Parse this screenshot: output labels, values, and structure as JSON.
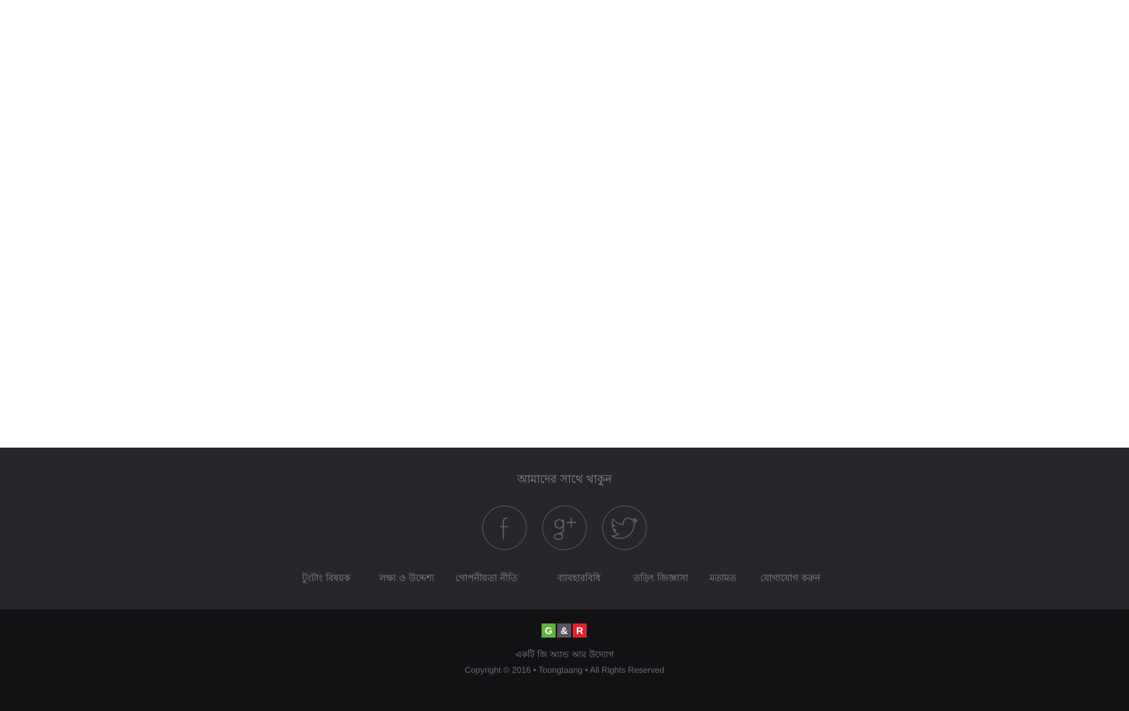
{
  "footer": {
    "follow_title": "আমাদের সাথে থাকুন",
    "social": [
      {
        "name": "facebook",
        "icon": "facebook-icon"
      },
      {
        "name": "google-plus",
        "icon": "google-plus-icon"
      },
      {
        "name": "twitter",
        "icon": "twitter-icon"
      }
    ],
    "links": [
      {
        "label": "টুংটাং বিষয়ক"
      },
      {
        "label": "লক্ষ্য ও উদ্দেশ্য"
      },
      {
        "label": "গোপনীয়তা নীতি"
      },
      {
        "label": "ব্যাবহারবিধি"
      },
      {
        "label": "তড়িৎ জিজ্ঞাসা"
      },
      {
        "label": "মতামত"
      },
      {
        "label": "যোগাযোগ করুন"
      }
    ]
  },
  "bottom": {
    "logo": {
      "g": "G",
      "amp": "&",
      "r": "R"
    },
    "initiative": "একটি জি অ্যান্ড আর উদ্যোগ",
    "copyright": "Copyright © 2016 • Toongtaang • All Rights Reserved"
  },
  "colors": {
    "footer_bg": "#26272c",
    "bottom_bg": "#121215",
    "text_muted": "#8a8c94",
    "logo_green": "#5fb336",
    "logo_gray": "#55575e",
    "logo_red": "#e0242c"
  }
}
